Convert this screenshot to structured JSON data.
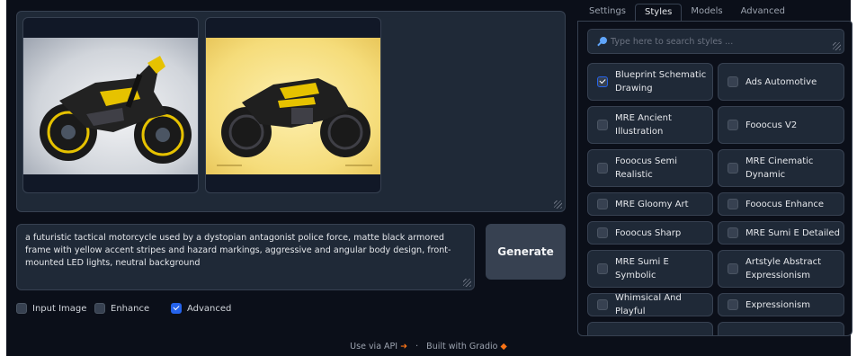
{
  "gallery": {
    "images": [
      {
        "alt": "black and yellow tactical motorcycle on grey background"
      },
      {
        "alt": "black and yellow tactical motorcycle on yellow background"
      }
    ]
  },
  "prompt": {
    "text": "a futuristic tactical motorcycle used by a dystopian antagonist police force, matte black armored frame with yellow accent stripes and hazard markings, aggressive and angular body design, front-mounted LED lights, neutral background"
  },
  "generate_label": "Generate",
  "options": [
    {
      "label": "Input Image",
      "checked": false
    },
    {
      "label": "Enhance",
      "checked": false
    },
    {
      "label": "Advanced",
      "checked": true
    }
  ],
  "footer": {
    "api_label": "Use via API",
    "separator": "·",
    "built_label": "Built with Gradio"
  },
  "tabs": [
    {
      "label": "Settings",
      "active": false
    },
    {
      "label": "Styles",
      "active": true
    },
    {
      "label": "Models",
      "active": false
    },
    {
      "label": "Advanced",
      "active": false
    }
  ],
  "styles": {
    "search_placeholder": "Type here to search styles ...",
    "items": [
      {
        "label": "Blueprint Schematic Drawing",
        "checked": true
      },
      {
        "label": "Ads Automotive",
        "checked": false
      },
      {
        "label": "MRE Ancient Illustration",
        "checked": false
      },
      {
        "label": "Fooocus V2",
        "checked": false
      },
      {
        "label": "Fooocus Semi Realistic",
        "checked": false
      },
      {
        "label": "MRE Cinematic Dynamic",
        "checked": false
      },
      {
        "label": "MRE Gloomy Art",
        "checked": false
      },
      {
        "label": "Fooocus Enhance",
        "checked": false
      },
      {
        "label": "Fooocus Sharp",
        "checked": false
      },
      {
        "label": "MRE Sumi E Detailed",
        "checked": false
      },
      {
        "label": "MRE Sumi E Symbolic",
        "checked": false
      },
      {
        "label": "Artstyle Abstract Expressionism",
        "checked": false
      },
      {
        "label": "Whimsical And Playful",
        "checked": false
      },
      {
        "label": "Expressionism",
        "checked": false
      }
    ]
  },
  "colors": {
    "background": "#0b0f19",
    "panel": "#1f2937",
    "border": "#374151",
    "accent": "#2563eb",
    "brand_orange": "#f97316"
  }
}
